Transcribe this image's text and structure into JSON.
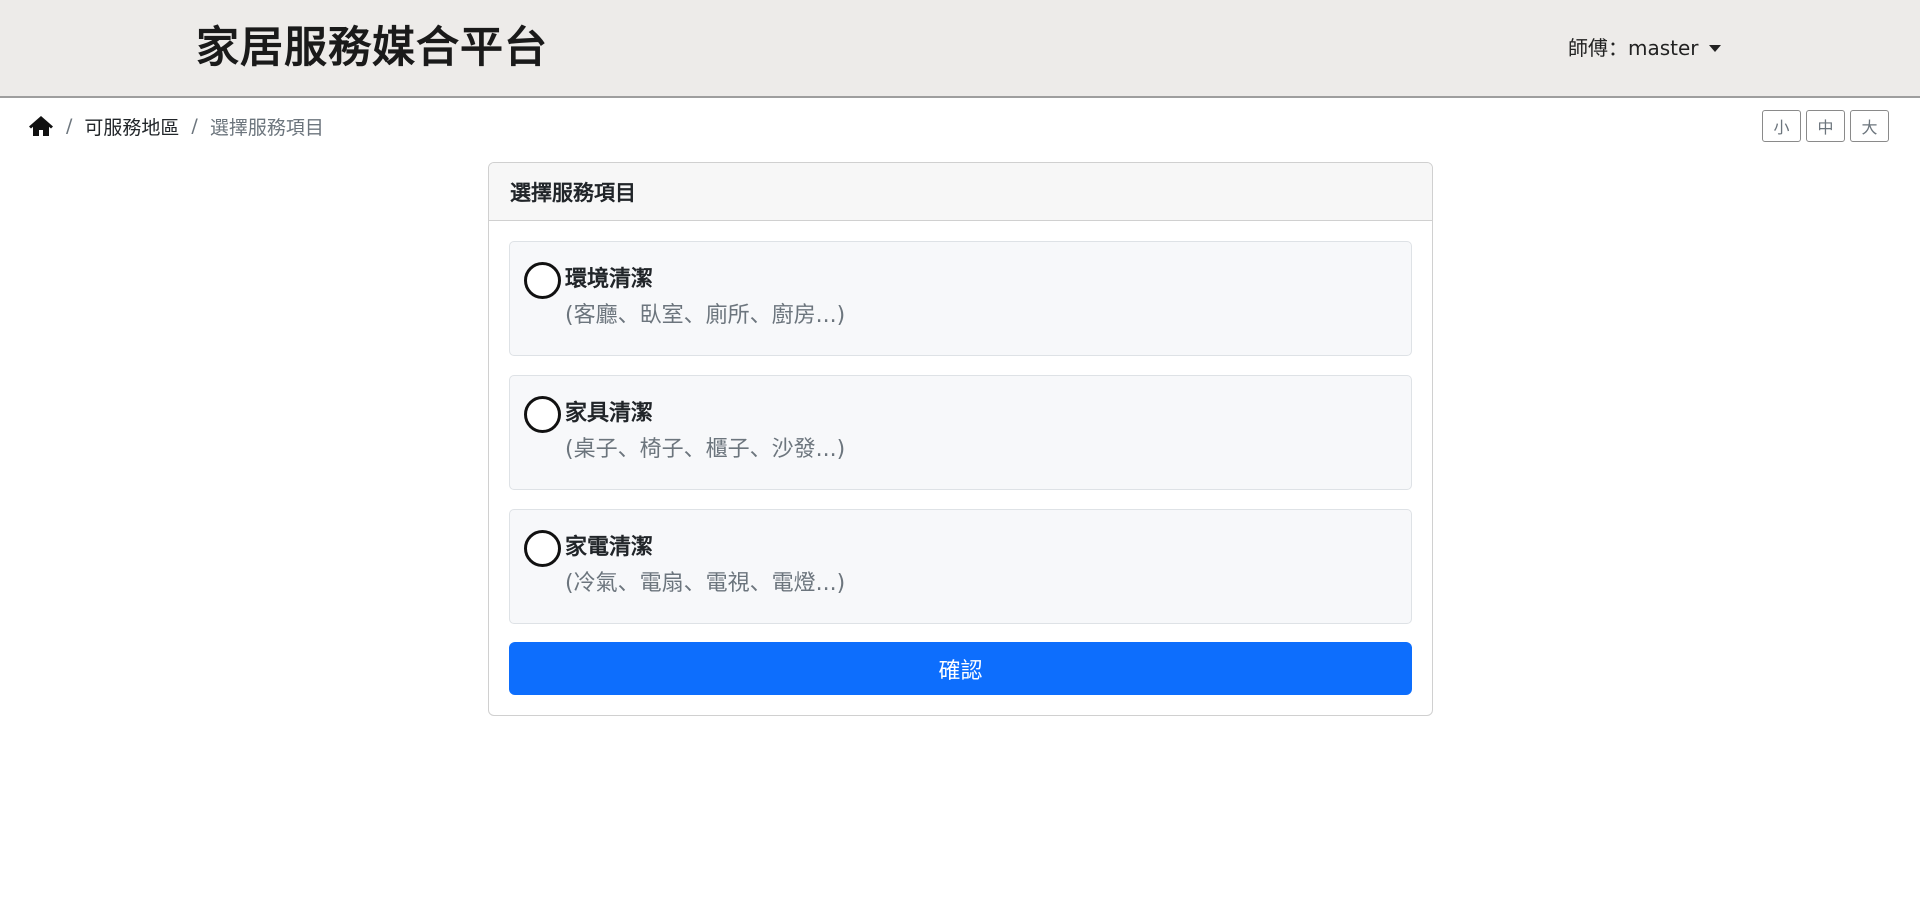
{
  "header": {
    "brand": "家居服務媒合平台",
    "user_menu_label": "師傅：master"
  },
  "breadcrumb": {
    "home_icon": "home-icon",
    "items": [
      "可服務地區",
      "選擇服務項目"
    ]
  },
  "font_size_buttons": [
    "小",
    "中",
    "大"
  ],
  "card": {
    "title": "選擇服務項目",
    "options": [
      {
        "title": "環境清潔",
        "desc": "(客廳、臥室、廁所、廚房...)"
      },
      {
        "title": "家具清潔",
        "desc": "(桌子、椅子、櫃子、沙發...)"
      },
      {
        "title": "家電清潔",
        "desc": "(冷氣、電扇、電視、電燈...)"
      }
    ],
    "confirm_label": "確認"
  },
  "colors": {
    "primary": "#0d6efd",
    "navbar_bg": "#edebe9",
    "muted_text": "#6c757d"
  }
}
